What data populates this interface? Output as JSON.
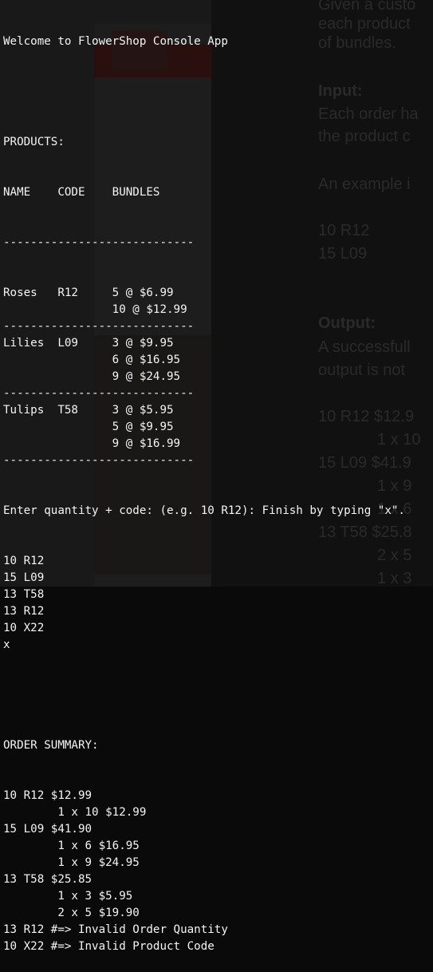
{
  "welcome": "Welcome to FlowerShop Console App",
  "products_header": "PRODUCTS:",
  "table_header": "NAME    CODE    BUNDLES",
  "divider": "----------------------------",
  "products": [
    {
      "name": "Roses",
      "code": "R12",
      "bundles": [
        "5 @ $6.99",
        "10 @ $12.99"
      ]
    },
    {
      "name": "Lilies",
      "code": "L09",
      "bundles": [
        "3 @ $9.95",
        "6 @ $16.95",
        "9 @ $24.95"
      ]
    },
    {
      "name": "Tulips",
      "code": "T58",
      "bundles": [
        "3 @ $5.95",
        "5 @ $9.95",
        "9 @ $16.99"
      ]
    }
  ],
  "prompt": "Enter quantity + code: (e.g. 10 R12): Finish by typing \"x\".",
  "inputs": [
    "10 R12",
    "15 L09",
    "13 T58",
    "13 R12",
    "10 X22",
    "x"
  ],
  "summary_header": "ORDER SUMMARY:",
  "summary": [
    "10 R12 $12.99",
    "        1 x 10 $12.99",
    "15 L09 $41.90",
    "        1 x 6 $16.95",
    "        1 x 9 $24.95",
    "13 T58 $25.85",
    "        1 x 3 $5.95",
    "        2 x 5 $19.90",
    "13 R12 #=> Invalid Order Quantity",
    "10 X22 #=> Invalid Product Code"
  ],
  "background_doc": {
    "lines": [
      "Given a custo",
      "each product",
      "of bundles.",
      "Input:",
      "Each order ha",
      "the product c",
      "An example i",
      "10 R12",
      "15 L09",
      "Output:",
      "A successfull",
      "output is not",
      "10 R12 $12.9",
      "1 x 10",
      "15 L09 $41.9",
      "1 x 9",
      "1 x 6",
      "13 T58 $25.8",
      "2 x 5",
      "1 x 3"
    ]
  }
}
